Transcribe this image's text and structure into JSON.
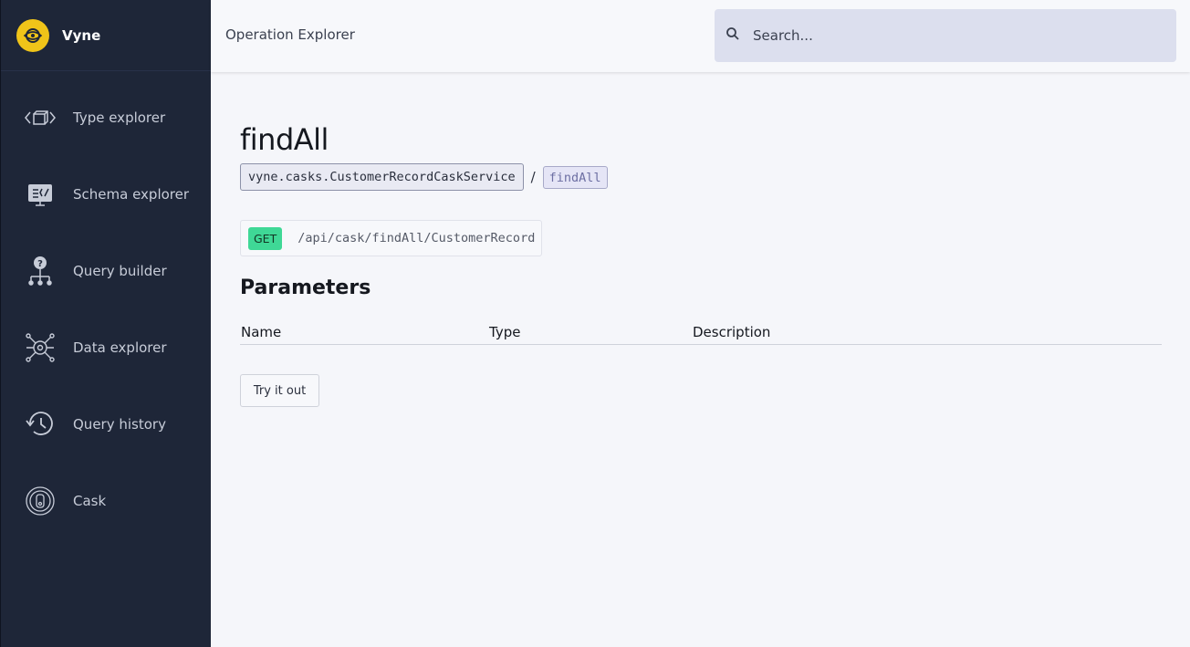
{
  "app": {
    "name": "Vyne",
    "logo_icon": "vyne-logo-icon",
    "logo_color": "#f0c419"
  },
  "sidebar": {
    "items": [
      {
        "label": "Type explorer",
        "icon": "type-explorer-icon"
      },
      {
        "label": "Schema explorer",
        "icon": "schema-explorer-icon"
      },
      {
        "label": "Query builder",
        "icon": "query-builder-icon"
      },
      {
        "label": "Data explorer",
        "icon": "data-explorer-icon"
      },
      {
        "label": "Query history",
        "icon": "history-icon"
      },
      {
        "label": "Cask",
        "icon": "cask-icon"
      }
    ]
  },
  "header": {
    "title": "Operation Explorer",
    "search_placeholder": "Search..."
  },
  "operation": {
    "name": "findAll",
    "service": "vyne.casks.CustomerRecordCaskService",
    "separator": "/",
    "operation_chip": "findAll",
    "method": "GET",
    "method_color": "#3fd896",
    "path": "/api/cask/findAll/CustomerRecord"
  },
  "parameters": {
    "title": "Parameters",
    "columns": [
      "Name",
      "Type",
      "Description"
    ],
    "rows": []
  },
  "actions": {
    "try_label": "Try it out"
  }
}
